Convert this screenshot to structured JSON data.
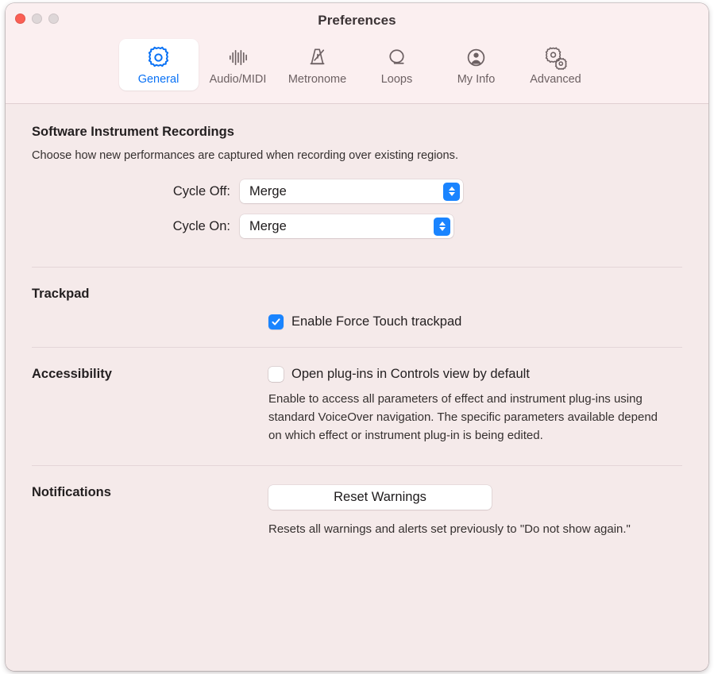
{
  "window": {
    "title": "Preferences",
    "traffic_lights": [
      {
        "name": "close",
        "color": "#fb5f54"
      },
      {
        "name": "minimize",
        "color": "#ded7d8"
      },
      {
        "name": "zoom",
        "color": "#ded7d8"
      }
    ],
    "accent_color": "#1a84ff",
    "toolbar_bg": "#fbeff0",
    "content_bg": "#f5eaea"
  },
  "toolbar": {
    "tabs": [
      {
        "label": "General",
        "icon": "gear-icon",
        "selected": true
      },
      {
        "label": "Audio/MIDI",
        "icon": "waveform-icon",
        "selected": false
      },
      {
        "label": "Metronome",
        "icon": "metronome-icon",
        "selected": false
      },
      {
        "label": "Loops",
        "icon": "loop-icon",
        "selected": false
      },
      {
        "label": "My Info",
        "icon": "person-circle-icon",
        "selected": false
      },
      {
        "label": "Advanced",
        "icon": "double-gear-icon",
        "selected": false
      }
    ]
  },
  "sections": {
    "software_instrument_recordings": {
      "title": "Software Instrument Recordings",
      "description": "Choose how new performances are captured when recording over existing regions.",
      "fields": [
        {
          "label": "Cycle Off:",
          "value": "Merge"
        },
        {
          "label": "Cycle On:",
          "value": "Merge"
        }
      ]
    },
    "trackpad": {
      "title": "Trackpad",
      "checkbox": {
        "label": "Enable Force Touch trackpad",
        "checked": true
      }
    },
    "accessibility": {
      "title": "Accessibility",
      "checkbox": {
        "label": "Open plug-ins in Controls view by default",
        "checked": false
      },
      "description": "Enable to access all parameters of effect and instrument plug-ins using standard VoiceOver navigation. The specific parameters available depend on which effect or instrument plug-in is being edited."
    },
    "notifications": {
      "title": "Notifications",
      "button_label": "Reset Warnings",
      "description": "Resets all warnings and alerts set previously to \"Do not show again.\""
    }
  }
}
